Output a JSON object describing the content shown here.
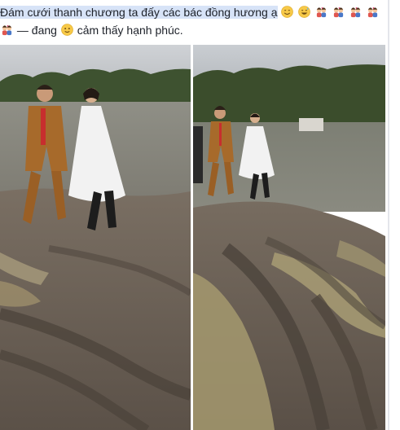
{
  "post": {
    "caption_text": "Đám cưới thanh chương ta đấy các bác đồng hương ạ",
    "feeling_prefix": "— đang",
    "feeling_text": "cảm thấy hạnh phúc."
  },
  "icons": {
    "smile": "smile-emoji-icon",
    "sweat": "sweat-smile-emoji-icon",
    "couple": "couple-kiss-emoji-icon",
    "happy": "slightly-smiling-face-icon"
  },
  "colors": {
    "text": "#1d2129",
    "highlight": "#d7e3f7",
    "sky": "#c9cdd3",
    "water": "#8a8a7e",
    "mud": "#6d6257",
    "trees": "#3b4d2c",
    "groom_suit": "#a56a2a",
    "bride_dress": "#f3f3f3"
  }
}
